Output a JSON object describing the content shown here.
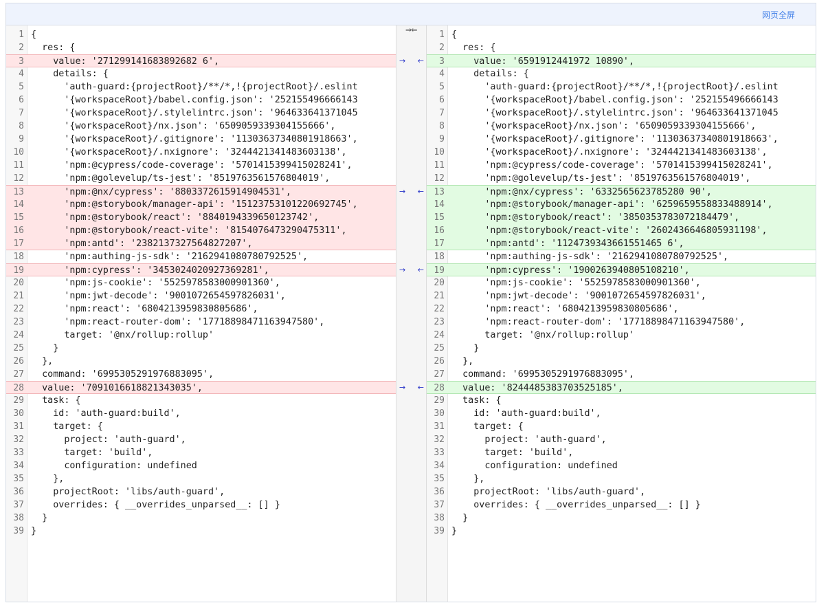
{
  "toolbar": {
    "fullscreen_label": "网页全屏"
  },
  "middle": {
    "swap_icon": "⇒⇐",
    "merge_right_icon": "→",
    "merge_left_icon": "←"
  },
  "left_lines": [
    {
      "n": "1",
      "t": "{",
      "k": ""
    },
    {
      "n": "2",
      "t": "  res: {",
      "k": ""
    },
    {
      "n": "3",
      "t": "    value: '271299141683892682 6',",
      "k": "del"
    },
    {
      "n": "4",
      "t": "    details: {",
      "k": ""
    },
    {
      "n": "5",
      "t": "      'auth-guard:{projectRoot}/**/*,!{projectRoot}/.eslint",
      "k": ""
    },
    {
      "n": "6",
      "t": "      '{workspaceRoot}/babel.config.json': '252155496666143",
      "k": ""
    },
    {
      "n": "7",
      "t": "      '{workspaceRoot}/.stylelintrc.json': '964633641371045",
      "k": ""
    },
    {
      "n": "8",
      "t": "      '{workspaceRoot}/nx.json': '6509059339304155666',",
      "k": ""
    },
    {
      "n": "9",
      "t": "      '{workspaceRoot}/.gitignore': '11303637340801918663',",
      "k": ""
    },
    {
      "n": "10",
      "t": "      '{workspaceRoot}/.nxignore': '3244421341483603138',",
      "k": ""
    },
    {
      "n": "11",
      "t": "      'npm:@cypress/code-coverage': '5701415399415028241',",
      "k": ""
    },
    {
      "n": "12",
      "t": "      'npm:@golevelup/ts-jest': '8519763561576804019',",
      "k": ""
    },
    {
      "n": "13",
      "t": "      'npm:@nx/cypress': '8803372615914904531',",
      "k": "del"
    },
    {
      "n": "14",
      "t": "      'npm:@storybook/manager-api': '15123753101220692745',",
      "k": "del"
    },
    {
      "n": "15",
      "t": "      'npm:@storybook/react': '8840194339650123742',",
      "k": "del"
    },
    {
      "n": "16",
      "t": "      'npm:@storybook/react-vite': '8154076473290475311',",
      "k": "del"
    },
    {
      "n": "17",
      "t": "      'npm:antd': '2382137327564827207',",
      "k": "del"
    },
    {
      "n": "18",
      "t": "      'npm:authing-js-sdk': '2162941080780792525',",
      "k": ""
    },
    {
      "n": "19",
      "t": "      'npm:cypress': '3453024020927369281',",
      "k": "del"
    },
    {
      "n": "20",
      "t": "      'npm:js-cookie': '5525978583000901360',",
      "k": ""
    },
    {
      "n": "21",
      "t": "      'npm:jwt-decode': '9001072654597826031',",
      "k": ""
    },
    {
      "n": "22",
      "t": "      'npm:react': '6804213959830805686',",
      "k": ""
    },
    {
      "n": "23",
      "t": "      'npm:react-router-dom': '17718898471163947580',",
      "k": ""
    },
    {
      "n": "24",
      "t": "      target: '@nx/rollup:rollup'",
      "k": ""
    },
    {
      "n": "25",
      "t": "    }",
      "k": ""
    },
    {
      "n": "26",
      "t": "  },",
      "k": ""
    },
    {
      "n": "27",
      "t": "  command: '6995305291976883095',",
      "k": ""
    },
    {
      "n": "28",
      "t": "  value: '7091016618821343035',",
      "k": "del"
    },
    {
      "n": "29",
      "t": "  task: {",
      "k": ""
    },
    {
      "n": "30",
      "t": "    id: 'auth-guard:build',",
      "k": ""
    },
    {
      "n": "31",
      "t": "    target: {",
      "k": ""
    },
    {
      "n": "32",
      "t": "      project: 'auth-guard',",
      "k": ""
    },
    {
      "n": "33",
      "t": "      target: 'build',",
      "k": ""
    },
    {
      "n": "34",
      "t": "      configuration: undefined",
      "k": ""
    },
    {
      "n": "35",
      "t": "    },",
      "k": ""
    },
    {
      "n": "36",
      "t": "    projectRoot: 'libs/auth-guard',",
      "k": ""
    },
    {
      "n": "37",
      "t": "    overrides: { __overrides_unparsed__: [] }",
      "k": ""
    },
    {
      "n": "38",
      "t": "  }",
      "k": ""
    },
    {
      "n": "39",
      "t": "}",
      "k": ""
    }
  ],
  "right_lines": [
    {
      "n": "1",
      "t": "{",
      "k": ""
    },
    {
      "n": "2",
      "t": "  res: {",
      "k": ""
    },
    {
      "n": "3",
      "t": "    value: '6591912441972 10890',",
      "k": "ins"
    },
    {
      "n": "4",
      "t": "    details: {",
      "k": ""
    },
    {
      "n": "5",
      "t": "      'auth-guard:{projectRoot}/**/*,!{projectRoot}/.eslint",
      "k": ""
    },
    {
      "n": "6",
      "t": "      '{workspaceRoot}/babel.config.json': '252155496666143",
      "k": ""
    },
    {
      "n": "7",
      "t": "      '{workspaceRoot}/.stylelintrc.json': '964633641371045",
      "k": ""
    },
    {
      "n": "8",
      "t": "      '{workspaceRoot}/nx.json': '6509059339304155666',",
      "k": ""
    },
    {
      "n": "9",
      "t": "      '{workspaceRoot}/.gitignore': '11303637340801918663',",
      "k": ""
    },
    {
      "n": "10",
      "t": "      '{workspaceRoot}/.nxignore': '3244421341483603138',",
      "k": ""
    },
    {
      "n": "11",
      "t": "      'npm:@cypress/code-coverage': '5701415399415028241',",
      "k": ""
    },
    {
      "n": "12",
      "t": "      'npm:@golevelup/ts-jest': '8519763561576804019',",
      "k": ""
    },
    {
      "n": "13",
      "t": "      'npm:@nx/cypress': '6332565623785280 90',",
      "k": "ins"
    },
    {
      "n": "14",
      "t": "      'npm:@storybook/manager-api': '6259659558833488914',",
      "k": "ins"
    },
    {
      "n": "15",
      "t": "      'npm:@storybook/react': '3850353783072184479',",
      "k": "ins"
    },
    {
      "n": "16",
      "t": "      'npm:@storybook/react-vite': '2602436646805931198',",
      "k": "ins"
    },
    {
      "n": "17",
      "t": "      'npm:antd': '1124739343661551465 6',",
      "k": "ins"
    },
    {
      "n": "18",
      "t": "      'npm:authing-js-sdk': '2162941080780792525',",
      "k": ""
    },
    {
      "n": "19",
      "t": "      'npm:cypress': '1900263940805108210',",
      "k": "ins"
    },
    {
      "n": "20",
      "t": "      'npm:js-cookie': '5525978583000901360',",
      "k": ""
    },
    {
      "n": "21",
      "t": "      'npm:jwt-decode': '9001072654597826031',",
      "k": ""
    },
    {
      "n": "22",
      "t": "      'npm:react': '6804213959830805686',",
      "k": ""
    },
    {
      "n": "23",
      "t": "      'npm:react-router-dom': '17718898471163947580',",
      "k": ""
    },
    {
      "n": "24",
      "t": "      target: '@nx/rollup:rollup'",
      "k": ""
    },
    {
      "n": "25",
      "t": "    }",
      "k": ""
    },
    {
      "n": "26",
      "t": "  },",
      "k": ""
    },
    {
      "n": "27",
      "t": "  command: '6995305291976883095',",
      "k": ""
    },
    {
      "n": "28",
      "t": "  value: '8244485383703525185',",
      "k": "ins"
    },
    {
      "n": "29",
      "t": "  task: {",
      "k": ""
    },
    {
      "n": "30",
      "t": "    id: 'auth-guard:build',",
      "k": ""
    },
    {
      "n": "31",
      "t": "    target: {",
      "k": ""
    },
    {
      "n": "32",
      "t": "      project: 'auth-guard',",
      "k": ""
    },
    {
      "n": "33",
      "t": "      target: 'build',",
      "k": ""
    },
    {
      "n": "34",
      "t": "      configuration: undefined",
      "k": ""
    },
    {
      "n": "35",
      "t": "    },",
      "k": ""
    },
    {
      "n": "36",
      "t": "    projectRoot: 'libs/auth-guard',",
      "k": ""
    },
    {
      "n": "37",
      "t": "    overrides: { __overrides_unparsed__: [] }",
      "k": ""
    },
    {
      "n": "38",
      "t": "  }",
      "k": ""
    },
    {
      "n": "39",
      "t": "}",
      "k": ""
    }
  ],
  "merge_rows": [
    "3",
    "13",
    "19",
    "28"
  ]
}
